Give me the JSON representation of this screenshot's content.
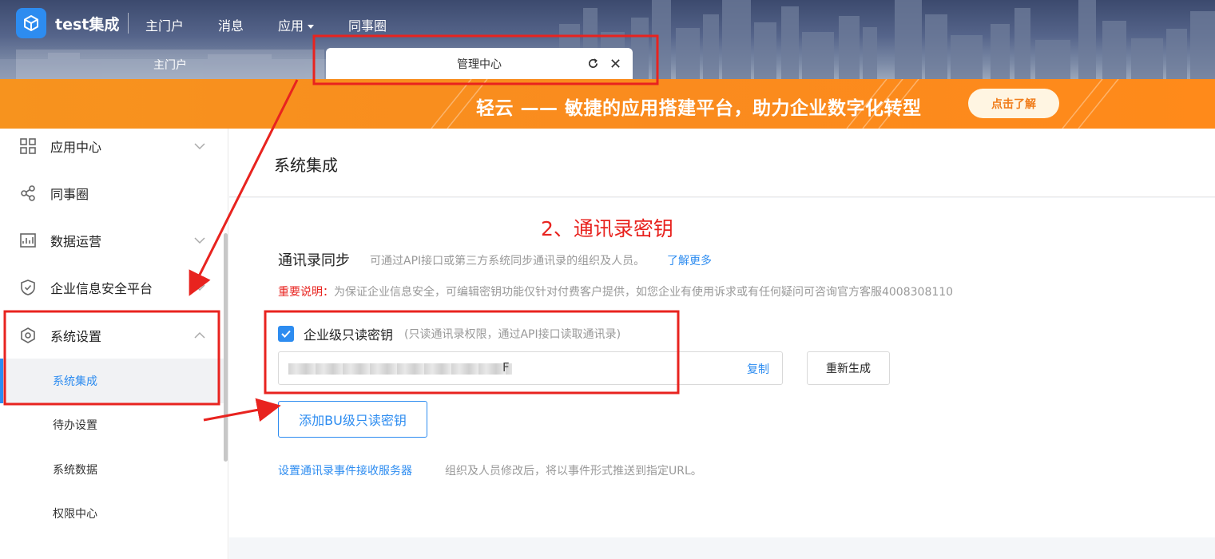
{
  "header": {
    "app_name": "test集成",
    "nav": [
      {
        "label": "主门户"
      },
      {
        "label": "消息"
      },
      {
        "label": "应用"
      },
      {
        "label": "同事圈"
      }
    ],
    "tabs": [
      {
        "label": "主门户"
      },
      {
        "label": "管理中心"
      }
    ]
  },
  "banner": {
    "text": "轻云 —— 敏捷的应用搭建平台，助力企业数字化转型",
    "button": "点击了解"
  },
  "sidebar": {
    "items": [
      {
        "label": "应用中心",
        "icon": "grid-icon"
      },
      {
        "label": "同事圈",
        "icon": "share-icon"
      },
      {
        "label": "数据运营",
        "icon": "chart-icon"
      },
      {
        "label": "企业信息安全平台",
        "icon": "shield-icon"
      },
      {
        "label": "系统设置",
        "icon": "hexagon-settings-icon"
      }
    ],
    "sub_items": [
      {
        "label": "系统集成"
      },
      {
        "label": "待办设置"
      },
      {
        "label": "系统数据"
      },
      {
        "label": "权限中心"
      }
    ]
  },
  "main": {
    "page_title": "系统集成",
    "annotation_title": "2、通讯录密钥",
    "section_title": "通讯录同步",
    "section_desc": "可通过API接口或第三方系统同步通讯录的组织及人员。",
    "section_link": "了解更多",
    "notice_label": "重要说明：",
    "notice_text": "为保证企业信息安全，可编辑密钥功能仅针对付费客户提供，如您企业有使用诉求或有任何疑问可咨询官方客服4008308110",
    "checkbox_label": "企业级只读密钥",
    "checkbox_hint": "(只读通讯录权限，通过API接口读取通讯录)",
    "checkbox_checked": true,
    "key_visible_tail": "F",
    "copy_label": "复制",
    "regen_label": "重新生成",
    "add_bu_label": "添加BU级只读密钥",
    "event_link": "设置通讯录事件接收服务器",
    "event_desc": "组织及人员修改后，将以事件形式推送到指定URL。"
  },
  "colors": {
    "accent": "#2d8cf0",
    "banner": "#f7931e",
    "annotation": "#e8231f"
  }
}
